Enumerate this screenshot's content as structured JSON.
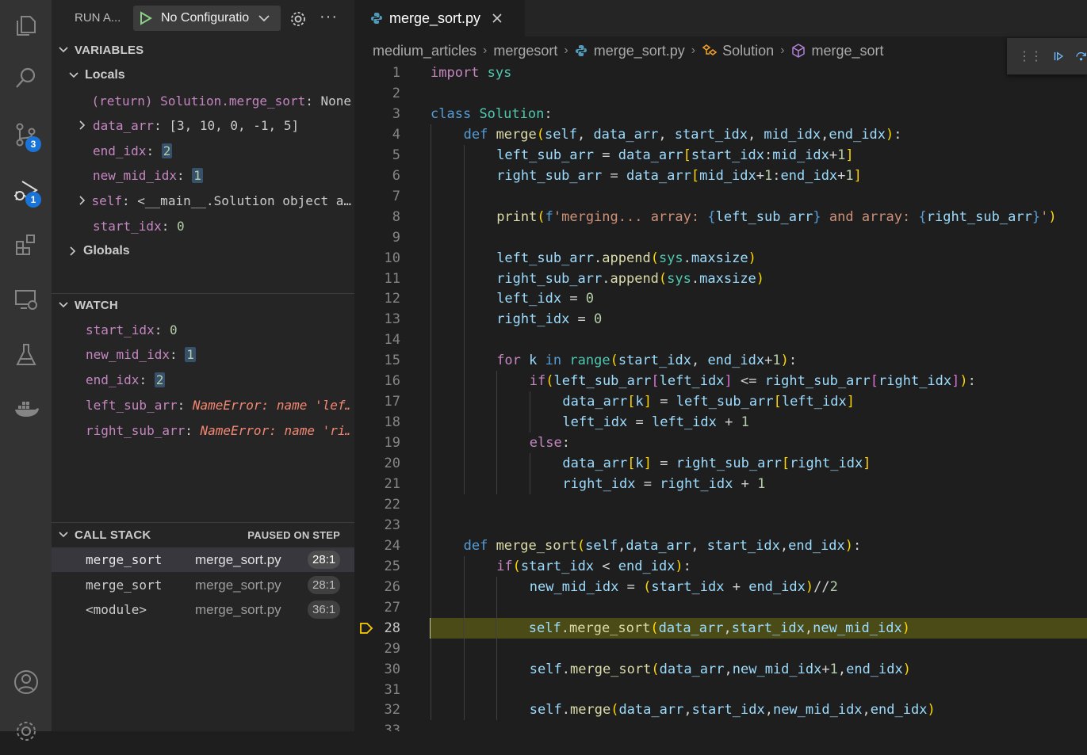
{
  "activity_bar": {
    "scm_badge": "3",
    "debug_badge": "1"
  },
  "sidebar": {
    "run_title": "RUN A...",
    "config_name": "No Configuratio",
    "variables_title": "VARIABLES",
    "locals_label": "Locals",
    "locals": [
      {
        "name": "(return) Solution.merge_sort",
        "sep": ": ",
        "value": "None",
        "expandable": false
      },
      {
        "name": "data_arr",
        "sep": ": ",
        "value": "[3, 10, 0, -1, 5]",
        "expandable": true
      },
      {
        "name": "end_idx",
        "sep": ": ",
        "value": "2",
        "expandable": false
      },
      {
        "name": "new_mid_idx",
        "sep": ": ",
        "value": "1",
        "expandable": false
      },
      {
        "name": "self",
        "sep": ": ",
        "value": "<__main__.Solution object a…",
        "expandable": true
      },
      {
        "name": "start_idx",
        "sep": ": ",
        "value": "0",
        "expandable": false
      }
    ],
    "globals_label": "Globals",
    "watch_title": "WATCH",
    "watch": [
      {
        "name": "start_idx",
        "sep": ": ",
        "value": "0",
        "error": false
      },
      {
        "name": "new_mid_idx",
        "sep": ": ",
        "value": "1",
        "error": false
      },
      {
        "name": "end_idx",
        "sep": ": ",
        "value": "2",
        "error": false
      },
      {
        "name": "left_sub_arr",
        "sep": ": ",
        "value": "NameError: name 'lef…",
        "error": true
      },
      {
        "name": "right_sub_arr",
        "sep": ": ",
        "value": "NameError: name 'ri…",
        "error": true
      }
    ],
    "callstack_title": "CALL STACK",
    "callstack_status": "PAUSED ON STEP",
    "frames": [
      {
        "func": "merge_sort",
        "file": "merge_sort.py",
        "pos": "28:1"
      },
      {
        "func": "merge_sort",
        "file": "merge_sort.py",
        "pos": "28:1"
      },
      {
        "func": "<module>",
        "file": "merge_sort.py",
        "pos": "36:1"
      }
    ]
  },
  "editor": {
    "tab_title": "merge_sort.py",
    "breadcrumbs": [
      "medium_articles",
      "mergesort",
      "merge_sort.py",
      "Solution",
      "merge_sort"
    ],
    "current_line": "28",
    "lines": [
      {
        "n": "1",
        "indent": 0,
        "code": [
          [
            "kw",
            "import"
          ],
          [
            "p",
            " "
          ],
          [
            "c",
            "sys"
          ]
        ]
      },
      {
        "n": "2",
        "indent": 0,
        "code": []
      },
      {
        "n": "3",
        "indent": 0,
        "code": [
          [
            "k",
            "class"
          ],
          [
            "p",
            " "
          ],
          [
            "c",
            "Solution"
          ],
          [
            "p",
            ":"
          ]
        ]
      },
      {
        "n": "4",
        "indent": 1,
        "code": [
          [
            "k",
            "def"
          ],
          [
            "p",
            " "
          ],
          [
            "f",
            "merge"
          ],
          [
            "b1",
            "("
          ],
          [
            "v",
            "self"
          ],
          [
            "p",
            ", "
          ],
          [
            "v",
            "data_arr"
          ],
          [
            "p",
            ", "
          ],
          [
            "v",
            "start_idx"
          ],
          [
            "p",
            ", "
          ],
          [
            "v",
            "mid_idx"
          ],
          [
            "p",
            ","
          ],
          [
            "v",
            "end_idx"
          ],
          [
            "b1",
            ")"
          ],
          [
            "p",
            ":"
          ]
        ]
      },
      {
        "n": "5",
        "indent": 2,
        "code": [
          [
            "v",
            "left_sub_arr"
          ],
          [
            "p",
            " = "
          ],
          [
            "v",
            "data_arr"
          ],
          [
            "b1",
            "["
          ],
          [
            "v",
            "start_idx"
          ],
          [
            "p",
            ":"
          ],
          [
            "v",
            "mid_idx"
          ],
          [
            "p",
            "+"
          ],
          [
            "n",
            "1"
          ],
          [
            "b1",
            "]"
          ]
        ]
      },
      {
        "n": "6",
        "indent": 2,
        "code": [
          [
            "v",
            "right_sub_arr"
          ],
          [
            "p",
            " = "
          ],
          [
            "v",
            "data_arr"
          ],
          [
            "b1",
            "["
          ],
          [
            "v",
            "mid_idx"
          ],
          [
            "p",
            "+"
          ],
          [
            "n",
            "1"
          ],
          [
            "p",
            ":"
          ],
          [
            "v",
            "end_idx"
          ],
          [
            "p",
            "+"
          ],
          [
            "n",
            "1"
          ],
          [
            "b1",
            "]"
          ]
        ]
      },
      {
        "n": "7",
        "indent": 2,
        "code": []
      },
      {
        "n": "8",
        "indent": 2,
        "code": [
          [
            "f",
            "print"
          ],
          [
            "b1",
            "("
          ],
          [
            "k",
            "f"
          ],
          [
            "s",
            "'merging... array: "
          ],
          [
            "k",
            "{"
          ],
          [
            "v",
            "left_sub_arr"
          ],
          [
            "k",
            "}"
          ],
          [
            "s",
            " and array: "
          ],
          [
            "k",
            "{"
          ],
          [
            "v",
            "right_sub_arr"
          ],
          [
            "k",
            "}"
          ],
          [
            "s",
            "'"
          ],
          [
            "b1",
            ")"
          ]
        ]
      },
      {
        "n": "9",
        "indent": 2,
        "code": []
      },
      {
        "n": "10",
        "indent": 2,
        "code": [
          [
            "v",
            "left_sub_arr"
          ],
          [
            "p",
            "."
          ],
          [
            "f",
            "append"
          ],
          [
            "b1",
            "("
          ],
          [
            "c",
            "sys"
          ],
          [
            "p",
            "."
          ],
          [
            "v",
            "maxsize"
          ],
          [
            "b1",
            ")"
          ]
        ]
      },
      {
        "n": "11",
        "indent": 2,
        "code": [
          [
            "v",
            "right_sub_arr"
          ],
          [
            "p",
            "."
          ],
          [
            "f",
            "append"
          ],
          [
            "b1",
            "("
          ],
          [
            "c",
            "sys"
          ],
          [
            "p",
            "."
          ],
          [
            "v",
            "maxsize"
          ],
          [
            "b1",
            ")"
          ]
        ]
      },
      {
        "n": "12",
        "indent": 2,
        "code": [
          [
            "v",
            "left_idx"
          ],
          [
            "p",
            " = "
          ],
          [
            "n",
            "0"
          ]
        ]
      },
      {
        "n": "13",
        "indent": 2,
        "code": [
          [
            "v",
            "right_idx"
          ],
          [
            "p",
            " = "
          ],
          [
            "n",
            "0"
          ]
        ]
      },
      {
        "n": "14",
        "indent": 2,
        "code": []
      },
      {
        "n": "15",
        "indent": 2,
        "code": [
          [
            "kw",
            "for"
          ],
          [
            "p",
            " "
          ],
          [
            "v",
            "k"
          ],
          [
            "p",
            " "
          ],
          [
            "k",
            "in"
          ],
          [
            "p",
            " "
          ],
          [
            "c",
            "range"
          ],
          [
            "b1",
            "("
          ],
          [
            "v",
            "start_idx"
          ],
          [
            "p",
            ", "
          ],
          [
            "v",
            "end_idx"
          ],
          [
            "p",
            "+"
          ],
          [
            "n",
            "1"
          ],
          [
            "b1",
            ")"
          ],
          [
            "p",
            ":"
          ]
        ]
      },
      {
        "n": "16",
        "indent": 3,
        "code": [
          [
            "kw",
            "if"
          ],
          [
            "b1",
            "("
          ],
          [
            "v",
            "left_sub_arr"
          ],
          [
            "b2",
            "["
          ],
          [
            "v",
            "left_idx"
          ],
          [
            "b2",
            "]"
          ],
          [
            "p",
            " <= "
          ],
          [
            "v",
            "right_sub_arr"
          ],
          [
            "b2",
            "["
          ],
          [
            "v",
            "right_idx"
          ],
          [
            "b2",
            "]"
          ],
          [
            "b1",
            ")"
          ],
          [
            "p",
            ":"
          ]
        ]
      },
      {
        "n": "17",
        "indent": 4,
        "code": [
          [
            "v",
            "data_arr"
          ],
          [
            "b1",
            "["
          ],
          [
            "v",
            "k"
          ],
          [
            "b1",
            "]"
          ],
          [
            "p",
            " = "
          ],
          [
            "v",
            "left_sub_arr"
          ],
          [
            "b1",
            "["
          ],
          [
            "v",
            "left_idx"
          ],
          [
            "b1",
            "]"
          ]
        ]
      },
      {
        "n": "18",
        "indent": 4,
        "code": [
          [
            "v",
            "left_idx"
          ],
          [
            "p",
            " = "
          ],
          [
            "v",
            "left_idx"
          ],
          [
            "p",
            " + "
          ],
          [
            "n",
            "1"
          ]
        ]
      },
      {
        "n": "19",
        "indent": 3,
        "code": [
          [
            "kw",
            "else"
          ],
          [
            "p",
            ":"
          ]
        ]
      },
      {
        "n": "20",
        "indent": 4,
        "code": [
          [
            "v",
            "data_arr"
          ],
          [
            "b1",
            "["
          ],
          [
            "v",
            "k"
          ],
          [
            "b1",
            "]"
          ],
          [
            "p",
            " = "
          ],
          [
            "v",
            "right_sub_arr"
          ],
          [
            "b1",
            "["
          ],
          [
            "v",
            "right_idx"
          ],
          [
            "b1",
            "]"
          ]
        ]
      },
      {
        "n": "21",
        "indent": 4,
        "code": [
          [
            "v",
            "right_idx"
          ],
          [
            "p",
            " = "
          ],
          [
            "v",
            "right_idx"
          ],
          [
            "p",
            " + "
          ],
          [
            "n",
            "1"
          ]
        ]
      },
      {
        "n": "22",
        "indent": 1,
        "code": []
      },
      {
        "n": "23",
        "indent": 1,
        "code": []
      },
      {
        "n": "24",
        "indent": 1,
        "code": [
          [
            "k",
            "def"
          ],
          [
            "p",
            " "
          ],
          [
            "f",
            "merge_sort"
          ],
          [
            "b1",
            "("
          ],
          [
            "v",
            "self"
          ],
          [
            "p",
            ","
          ],
          [
            "v",
            "data_arr"
          ],
          [
            "p",
            ", "
          ],
          [
            "v",
            "start_idx"
          ],
          [
            "p",
            ","
          ],
          [
            "v",
            "end_idx"
          ],
          [
            "b1",
            ")"
          ],
          [
            "p",
            ":"
          ]
        ]
      },
      {
        "n": "25",
        "indent": 2,
        "code": [
          [
            "kw",
            "if"
          ],
          [
            "b1",
            "("
          ],
          [
            "v",
            "start_idx"
          ],
          [
            "p",
            " < "
          ],
          [
            "v",
            "end_idx"
          ],
          [
            "b1",
            ")"
          ],
          [
            "p",
            ":"
          ]
        ]
      },
      {
        "n": "26",
        "indent": 3,
        "code": [
          [
            "v",
            "new_mid_idx"
          ],
          [
            "p",
            " = "
          ],
          [
            "b1",
            "("
          ],
          [
            "v",
            "start_idx"
          ],
          [
            "p",
            " + "
          ],
          [
            "v",
            "end_idx"
          ],
          [
            "b1",
            ")"
          ],
          [
            "p",
            "//"
          ],
          [
            "n",
            "2"
          ]
        ]
      },
      {
        "n": "27",
        "indent": 3,
        "code": []
      },
      {
        "n": "28",
        "indent": 3,
        "code": [
          [
            "v",
            "self"
          ],
          [
            "p",
            "."
          ],
          [
            "f",
            "merge_sort"
          ],
          [
            "b1",
            "("
          ],
          [
            "v",
            "data_arr"
          ],
          [
            "p",
            ","
          ],
          [
            "v",
            "start_idx"
          ],
          [
            "p",
            ","
          ],
          [
            "v",
            "new_mid_idx"
          ],
          [
            "b1",
            ")"
          ]
        ]
      },
      {
        "n": "29",
        "indent": 3,
        "code": []
      },
      {
        "n": "30",
        "indent": 3,
        "code": [
          [
            "v",
            "self"
          ],
          [
            "p",
            "."
          ],
          [
            "f",
            "merge_sort"
          ],
          [
            "b1",
            "("
          ],
          [
            "v",
            "data_arr"
          ],
          [
            "p",
            ","
          ],
          [
            "v",
            "new_mid_idx"
          ],
          [
            "p",
            "+"
          ],
          [
            "n",
            "1"
          ],
          [
            "p",
            ","
          ],
          [
            "v",
            "end_idx"
          ],
          [
            "b1",
            ")"
          ]
        ]
      },
      {
        "n": "31",
        "indent": 3,
        "code": []
      },
      {
        "n": "32",
        "indent": 3,
        "code": [
          [
            "v",
            "self"
          ],
          [
            "p",
            "."
          ],
          [
            "f",
            "merge"
          ],
          [
            "b1",
            "("
          ],
          [
            "v",
            "data_arr"
          ],
          [
            "p",
            ","
          ],
          [
            "v",
            "start_idx"
          ],
          [
            "p",
            ","
          ],
          [
            "v",
            "new_mid_idx"
          ],
          [
            "p",
            ","
          ],
          [
            "v",
            "end_idx"
          ],
          [
            "b1",
            ")"
          ]
        ]
      },
      {
        "n": "33",
        "indent": 0,
        "code": []
      }
    ]
  }
}
